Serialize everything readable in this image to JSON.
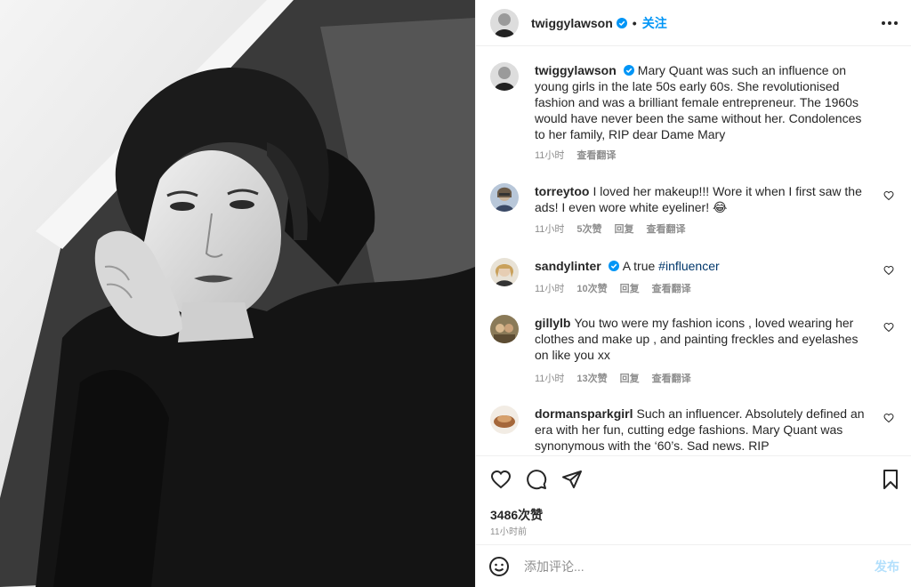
{
  "header": {
    "username": "twiggylawson",
    "dot": "•",
    "follow_label": "关注",
    "more_icon": "more-horizontal-icon"
  },
  "caption": {
    "username": "twiggylawson",
    "text": "Mary Quant was such an influence on young girls in the late 50s early 60s. She revolutionised fashion and was a brilliant female entrepreneur. The 1960s would have never been the same without her. Condolences to her family, RIP dear Dame Mary",
    "time": "11小时",
    "translate": "查看翻译"
  },
  "comments": [
    {
      "username": "torreytoo",
      "text": "I loved her makeup!!! Wore it when I first saw the ads! I even wore white eyeliner! 😂",
      "time": "11小时",
      "likes": "5次赞",
      "reply": "回复",
      "translate": "查看翻译"
    },
    {
      "username": "sandylinter",
      "text_prefix": "A true ",
      "hashtag": "#influencer",
      "time": "11小时",
      "likes": "10次赞",
      "reply": "回复",
      "translate": "查看翻译"
    },
    {
      "username": "gillylb",
      "text": "You two were my fashion icons , loved wearing her clothes and make up , and painting freckles and eyelashes on like you xx",
      "time": "11小时",
      "likes": "13次赞",
      "reply": "回复",
      "translate": "查看翻译"
    },
    {
      "username": "dormansparkgirl",
      "text": "Such an influencer. Absolutely defined an era with her fun, cutting edge fashions. Mary Quant was synonymous with the ‘60’s. Sad news. RIP"
    }
  ],
  "actions": {
    "like_icon": "heart-icon",
    "comment_icon": "comment-icon",
    "share_icon": "paper-plane-icon",
    "save_icon": "bookmark-icon",
    "likes_count": "3486次赞",
    "posted_time": "11小时前"
  },
  "add_comment": {
    "emoji_icon": "emoji-icon",
    "placeholder": "添加评论...",
    "post_label": "发布"
  },
  "colors": {
    "accent": "#0095f6",
    "link": "#00376b",
    "muted": "#8e8e8e",
    "post_disabled": "#b2dffc"
  }
}
